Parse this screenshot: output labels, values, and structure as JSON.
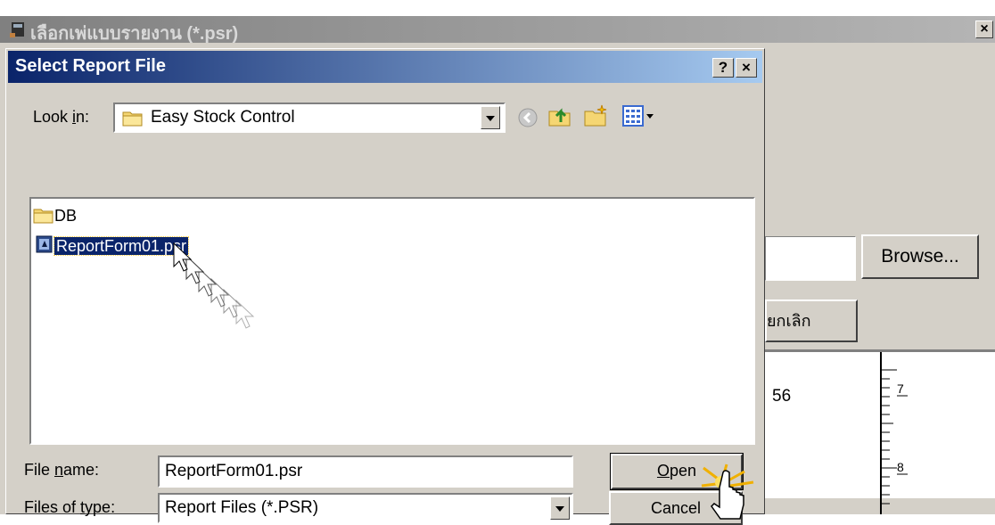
{
  "outer_window": {
    "title": "เลือกเพ่แบบรายงาน (*.psr)",
    "close_label": "×",
    "browse_label": "Browse...",
    "cancel_label": "ยกเลิก",
    "ruler_value": "56",
    "ruler_marks": [
      "7",
      "8"
    ]
  },
  "dialog": {
    "title": "Select Report File",
    "help_label": "?",
    "close_label": "×",
    "look_in_label_pre": "Look ",
    "look_in_label_u": "i",
    "look_in_label_post": "n:",
    "look_in_value": "Easy Stock Control",
    "files": [
      {
        "name": "DB",
        "type": "folder",
        "selected": false
      },
      {
        "name": "ReportForm01.psr",
        "type": "file",
        "selected": true
      }
    ],
    "file_name_label_pre": "File ",
    "file_name_label_u": "n",
    "file_name_label_post": "ame:",
    "file_name_value": "ReportForm01.psr",
    "file_type_label_pre": "Files of ",
    "file_type_label_u": "t",
    "file_type_label_post": "ype:",
    "file_type_value": "Report Files (*.PSR)",
    "open_label_u": "O",
    "open_label_post": "pen",
    "cancel_label": "Cancel"
  },
  "colors": {
    "title_active": "#0a246a",
    "title_gradient_end": "#a6caf0",
    "face": "#d4d0c8",
    "selection": "#0a246a"
  }
}
